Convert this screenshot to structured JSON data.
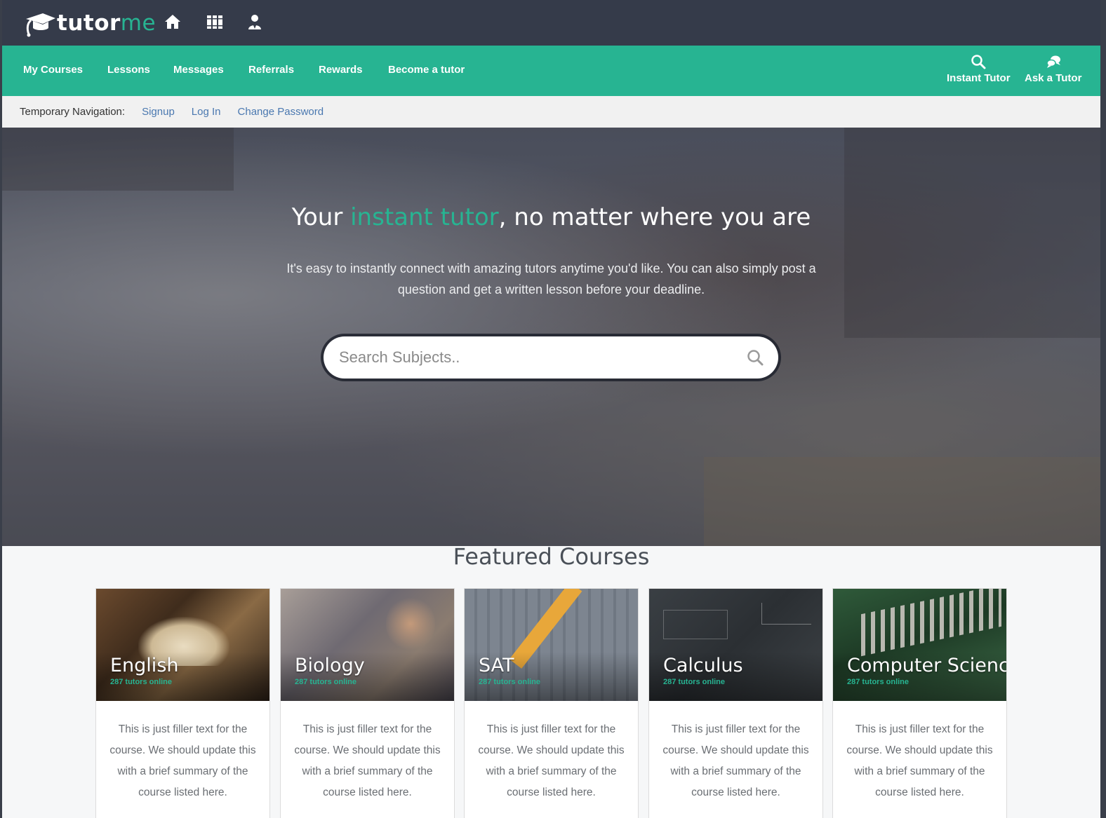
{
  "brand": {
    "name_primary": "tutor",
    "name_accent": "me"
  },
  "topbar_icons": [
    "home-icon",
    "library-icon",
    "tutor-profile-icon"
  ],
  "nav": {
    "items": [
      "My Courses",
      "Lessons",
      "Messages",
      "Referrals",
      "Rewards",
      "Become a tutor"
    ],
    "instant_tutor": "Instant Tutor",
    "ask_tutor": "Ask a Tutor"
  },
  "temp_nav": {
    "label": "Temporary Navigation:",
    "links": [
      "Signup",
      "Log In",
      "Change Password"
    ]
  },
  "hero": {
    "title_before": "Your ",
    "title_highlight": "instant tutor",
    "title_after": ", no matter where you are",
    "subtitle": "It's easy to instantly connect with amazing tutors anytime you'd like. You can also simply post a question and get a written lesson before your deadline.",
    "search_placeholder": "Search Subjects.."
  },
  "featured": {
    "title": "Featured Courses",
    "courses": [
      {
        "name": "English",
        "online": "287 tutors online",
        "desc": "This is just filler text for the course. We should update this with a brief summary of the course listed here."
      },
      {
        "name": "Biology",
        "online": "287 tutors online",
        "desc": "This is just filler text for the course. We should update this with a brief summary of the course listed here."
      },
      {
        "name": "SAT",
        "online": "287 tutors online",
        "desc": "This is just filler text for the course. We should update this with a brief summary of the course listed here."
      },
      {
        "name": "Calculus",
        "online": "287 tutors online",
        "desc": "This is just filler text for the course. We should update this with a brief summary of the course listed here."
      },
      {
        "name": "Computer Science",
        "online": "287 tutors online",
        "desc": "This is just filler text for the course. We should update this with a brief summary of the course listed here."
      }
    ]
  },
  "colors": {
    "accent": "#27b492",
    "topbar": "#353b4a",
    "link": "#4a78b0"
  }
}
